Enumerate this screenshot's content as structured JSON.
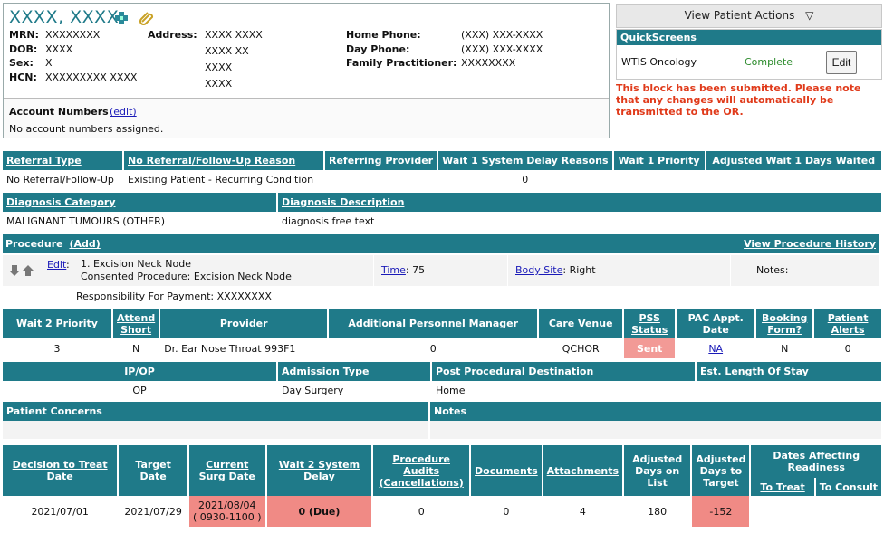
{
  "patient": {
    "name": "XXXX, XXXX",
    "mrn_label": "MRN:",
    "mrn": "XXXXXXXX",
    "dob_label": "DOB:",
    "dob": "XXXX",
    "sex_label": "Sex:",
    "sex": "X",
    "hcn_label": "HCN:",
    "hcn": "XXXXXXXXX XXXX",
    "address_label": "Address:",
    "address_lines": [
      "XXXX XXXX",
      "XXXX XX",
      "XXXX",
      "XXXX"
    ],
    "home_phone_label": "Home Phone:",
    "home_phone": "(XXX) XXX-XXXX",
    "day_phone_label": "Day Phone:",
    "day_phone": "(XXX) XXX-XXXX",
    "fp_label": "Family Practitioner:",
    "fp": "XXXXXXXX",
    "account_title": "Account Numbers",
    "account_edit": "(edit)",
    "account_text": "No account numbers assigned."
  },
  "actions": {
    "view_patient_actions": "View Patient Actions",
    "quickscreens_title": "QuickScreens",
    "qs_name": "WTIS Oncology",
    "qs_status": "Complete",
    "qs_edit": "Edit",
    "warning": "This block has been submitted. Please note that any changes will automatically be transmitted to the OR."
  },
  "referral": {
    "headers": [
      "Referral Type",
      "No Referral/Follow-Up Reason",
      "Referring Provider",
      "Wait 1 System Delay Reasons",
      "Wait 1 Priority",
      "Adjusted Wait 1 Days Waited"
    ],
    "values": [
      "No Referral/Follow-Up",
      "Existing Patient - Recurring Condition",
      "",
      "0",
      "",
      ""
    ]
  },
  "diagnosis": {
    "headers": [
      "Diagnosis Category",
      "Diagnosis Description"
    ],
    "values": [
      "MALIGNANT TUMOURS (OTHER)",
      "diagnosis free text"
    ]
  },
  "procedure": {
    "title": "Procedure",
    "add": "(Add)",
    "history": "View Procedure History",
    "edit": "Edit",
    "colon": ":",
    "line1": "1. Excision Neck Node",
    "line2": "Consented Procedure: Excision Neck Node",
    "time_label": "Time",
    "time_value": ": 75",
    "body_site_label": "Body Site",
    "body_site_value": ": Right",
    "notes_label": "Notes:",
    "payment": "Responsibility For Payment: XXXXXXXX"
  },
  "wait2": {
    "headers": [
      "Wait 2 Priority",
      "Attend Short",
      "Provider",
      "Additional Personnel Manager",
      "Care Venue",
      "PSS Status",
      "PAC Appt. Date",
      "Booking Form?",
      "Patient Alerts"
    ],
    "values": [
      "3",
      "N",
      "Dr. Ear Nose Throat 993F1",
      "0",
      "QCHOR",
      "Sent",
      "NA",
      "N",
      "0"
    ]
  },
  "admission": {
    "headers": [
      "IP/OP",
      "Admission Type",
      "Post Procedural Destination",
      "Est. Length Of Stay"
    ],
    "values": [
      "OP",
      "Day Surgery",
      "Home",
      ""
    ]
  },
  "concerns": {
    "headers": [
      "Patient Concerns",
      "Notes"
    ]
  },
  "dates": {
    "headers": [
      "Decision to Treat Date",
      "Target Date",
      "Current Surg Date",
      "Wait 2 System Delay",
      "Procedure Audits (Cancellations)",
      "Documents",
      "Attachments",
      "Adjusted Days on List",
      "Adjusted Days to Target",
      "Dates Affecting Readiness"
    ],
    "sub_headers": [
      "To Treat",
      "To Consult"
    ],
    "values": [
      "2021/07/01",
      "2021/07/29",
      "2021/08/04",
      "( 0930-1100 )",
      "0 (Due)",
      "0",
      "0",
      "4",
      "180",
      "-152",
      "",
      ""
    ]
  },
  "colors": {
    "teal": "#1f7a89",
    "alert_pink": "#f08a85",
    "warning_red": "#e03a1a",
    "complete_green": "#2a8a2a"
  }
}
